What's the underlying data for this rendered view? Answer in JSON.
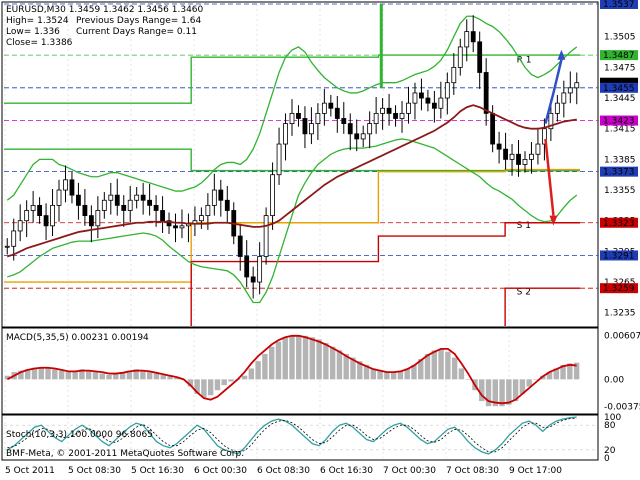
{
  "header": {
    "symbol_line": "EURUSD,M30  1.3459 1.3462 1.3456 1.3460",
    "high": "High= 1.3524",
    "low": "Low= 1.336",
    "close": "Close= 1.3386",
    "prev_range": "Previous Days Range= 1.64",
    "cur_range": "Current Days Range= 0.11"
  },
  "copyright": "BMF-Meta, © 2001-2011 MetaQuotes Software Corp.",
  "colors": {
    "background": "#ffffff",
    "grid": "#c8c8c8",
    "price": "#000000",
    "bollinger": "#32b432",
    "ma_slow": "#8b1a1a",
    "ma_fast": "#e8a000",
    "pivot_green": "#32b432",
    "support": "#c80000",
    "resistance_orange": "#e8a000",
    "forecast_up": "#3050c8",
    "forecast_down": "#dc1e1e",
    "macd_hist": "#b4b4b4",
    "macd_signal": "#c80000",
    "stoch_main": "#32a0a0",
    "stoch_signal": "#000000"
  },
  "chart_data": [
    {
      "type": "candlestick",
      "panel": "price",
      "title": "EURUSD,M30",
      "ylim": [
        1.3222,
        1.3537
      ],
      "y_ticks": [
        "1.3505",
        "1.3475",
        "1.3445",
        "1.3415",
        "1.3385",
        "1.3355",
        "1.3325",
        "1.3295",
        "1.3265",
        "1.3235"
      ],
      "x_ticks": [
        "5 Oct 2011",
        "5 Oct 08:30",
        "5 Oct 16:30",
        "6 Oct 00:30",
        "6 Oct 08:30",
        "6 Oct 16:30",
        "7 Oct 00:30",
        "7 Oct 08:30",
        "9 Oct 17:00"
      ],
      "price_labels": [
        {
          "value": "1.3537",
          "level": 1.3537,
          "color": "#1e3cb4"
        },
        {
          "value": "1.3487",
          "level": 1.3487,
          "color": "#32b432"
        },
        {
          "value": "1.3460",
          "level": 1.346,
          "color": "#000000"
        },
        {
          "value": "1.3455",
          "level": 1.3455,
          "color": "#1e3cb4"
        },
        {
          "value": "1.3423",
          "level": 1.3423,
          "color": "#c800c8"
        },
        {
          "value": "1.3373",
          "level": 1.3373,
          "color": "#1e3cb4"
        },
        {
          "value": "1.3323",
          "level": 1.3323,
          "color": "#c80000"
        },
        {
          "value": "1.3291",
          "level": 1.3291,
          "color": "#1e3cb4"
        },
        {
          "value": "1.3259",
          "level": 1.3259,
          "color": "#c80000"
        }
      ],
      "level_labels": [
        {
          "text": "R 1",
          "level": 1.348,
          "color": "#e8a000"
        },
        {
          "text": "S 1",
          "level": 1.3318,
          "color": "#e8a000"
        },
        {
          "text": "S 2",
          "level": 1.3253,
          "color": "#e8a000"
        }
      ],
      "dashed_levels": [
        {
          "level": 1.3537,
          "color": "#1e3cb4"
        },
        {
          "level": 1.3455,
          "color": "#1e3cb4"
        },
        {
          "level": 1.3423,
          "color": "#c800c8"
        },
        {
          "level": 1.3373,
          "color": "#1e3cb4"
        },
        {
          "level": 1.3291,
          "color": "#1e3cb4"
        },
        {
          "level": 1.3487,
          "color": "#32b432"
        },
        {
          "level": 1.3323,
          "color": "#c80000"
        },
        {
          "level": 1.3259,
          "color": "#c80000"
        }
      ],
      "close_series": [
        1.33,
        1.3315,
        1.3325,
        1.3335,
        1.334,
        1.333,
        1.332,
        1.334,
        1.3355,
        1.3365,
        1.335,
        1.334,
        1.333,
        1.332,
        1.3335,
        1.3345,
        1.335,
        1.334,
        1.3335,
        1.3345,
        1.335,
        1.3345,
        1.334,
        1.3335,
        1.3325,
        1.332,
        1.3318,
        1.332,
        1.3322,
        1.3325,
        1.333,
        1.334,
        1.3355,
        1.3345,
        1.3335,
        1.331,
        1.329,
        1.327,
        1.3265,
        1.329,
        1.333,
        1.337,
        1.34,
        1.342,
        1.343,
        1.3425,
        1.341,
        1.342,
        1.343,
        1.344,
        1.3435,
        1.3425,
        1.342,
        1.341,
        1.3405,
        1.341,
        1.342,
        1.343,
        1.3435,
        1.343,
        1.3425,
        1.343,
        1.344,
        1.345,
        1.3445,
        1.344,
        1.3435,
        1.3445,
        1.346,
        1.3475,
        1.3495,
        1.351,
        1.35,
        1.347,
        1.343,
        1.34,
        1.3395,
        1.3385,
        1.339,
        1.338,
        1.3385,
        1.339,
        1.34,
        1.3415,
        1.343,
        1.344,
        1.345,
        1.3455,
        1.346
      ],
      "bb_upper": [
        1.3345,
        1.335,
        1.336,
        1.337,
        1.338,
        1.3385,
        1.3385,
        1.3385,
        1.338,
        1.3378,
        1.3375,
        1.3372,
        1.337,
        1.3368,
        1.3368,
        1.337,
        1.3372,
        1.3372,
        1.337,
        1.3368,
        1.3366,
        1.3364,
        1.3362,
        1.336,
        1.3358,
        1.3356,
        1.3354,
        1.3354,
        1.3356,
        1.3358,
        1.3362,
        1.3368,
        1.3375,
        1.338,
        1.3382,
        1.3382,
        1.338,
        1.3385,
        1.3395,
        1.341,
        1.343,
        1.345,
        1.347,
        1.3485,
        1.3492,
        1.3495,
        1.349,
        1.348,
        1.3472,
        1.3465,
        1.346,
        1.3455,
        1.3452,
        1.345,
        1.345,
        1.3452,
        1.3455,
        1.3458,
        1.346,
        1.346,
        1.346,
        1.3462,
        1.3465,
        1.3468,
        1.347,
        1.3472,
        1.3476,
        1.3482,
        1.3492,
        1.3505,
        1.3518,
        1.3525,
        1.3525,
        1.3522,
        1.3518,
        1.3515,
        1.351,
        1.3503,
        1.3495,
        1.3485,
        1.3475,
        1.3468,
        1.3465,
        1.3468,
        1.3472,
        1.3478,
        1.3484,
        1.349,
        1.3495
      ],
      "bb_lower": [
        1.327,
        1.3272,
        1.3275,
        1.328,
        1.3285,
        1.329,
        1.3294,
        1.3298,
        1.33,
        1.3302,
        1.3304,
        1.3305,
        1.3305,
        1.3305,
        1.3306,
        1.3307,
        1.3308,
        1.3309,
        1.331,
        1.3311,
        1.3312,
        1.3313,
        1.3312,
        1.331,
        1.3306,
        1.33,
        1.3295,
        1.329,
        1.3285,
        1.3282,
        1.328,
        1.3279,
        1.3278,
        1.3277,
        1.3276,
        1.3272,
        1.3265,
        1.3255,
        1.3245,
        1.3245,
        1.3255,
        1.327,
        1.329,
        1.331,
        1.333,
        1.335,
        1.3362,
        1.3372,
        1.338,
        1.3385,
        1.339,
        1.3393,
        1.3395,
        1.3396,
        1.3396,
        1.3396,
        1.3397,
        1.3398,
        1.34,
        1.3402,
        1.3404,
        1.3405,
        1.3404,
        1.3402,
        1.34,
        1.3398,
        1.3396,
        1.3392,
        1.3388,
        1.3384,
        1.338,
        1.3376,
        1.3372,
        1.3368,
        1.3362,
        1.3357,
        1.3354,
        1.335,
        1.3346,
        1.334,
        1.3335,
        1.333,
        1.3326,
        1.3324,
        1.3325,
        1.333,
        1.3338,
        1.3345,
        1.335
      ],
      "ma_slow": [
        1.329,
        1.3292,
        1.3295,
        1.3298,
        1.33,
        1.3302,
        1.3304,
        1.3306,
        1.3308,
        1.331,
        1.3312,
        1.3314,
        1.3315,
        1.3316,
        1.3317,
        1.3318,
        1.3319,
        1.332,
        1.3321,
        1.3322,
        1.3323,
        1.3323,
        1.3324,
        1.3324,
        1.3324,
        1.3324,
        1.3323,
        1.3323,
        1.3322,
        1.3322,
        1.3322,
        1.3322,
        1.3323,
        1.3323,
        1.3323,
        1.3322,
        1.3321,
        1.332,
        1.3319,
        1.3319,
        1.332,
        1.3322,
        1.3325,
        1.333,
        1.3335,
        1.334,
        1.3345,
        1.335,
        1.3355,
        1.336,
        1.3364,
        1.3368,
        1.3371,
        1.3374,
        1.3377,
        1.338,
        1.3383,
        1.3386,
        1.3389,
        1.3392,
        1.3395,
        1.3398,
        1.3401,
        1.3404,
        1.3407,
        1.341,
        1.3413,
        1.3417,
        1.3421,
        1.3426,
        1.3432,
        1.3436,
        1.3438,
        1.3436,
        1.3433,
        1.343,
        1.3427,
        1.3424,
        1.3421,
        1.3418,
        1.3416,
        1.3415,
        1.3415,
        1.3416,
        1.3418,
        1.342,
        1.3422,
        1.3423,
        1.3424
      ],
      "forecast_up": [
        [
          1.344,
          1.34
        ],
        [
          1.348,
          1.342
        ],
        [
          1.351,
          1.3455
        ]
      ],
      "forecast_down": [
        [
          1.3425,
          1.3385
        ],
        [
          1.336,
          1.33
        ]
      ]
    },
    {
      "type": "histogram+line",
      "panel": "macd",
      "title": "MACD(5,35,5) 0.00231 0.00194",
      "ylim": [
        -0.0045,
        0.0068
      ],
      "y_ticks": [
        "0.00607",
        "0.00",
        "-0.00375"
      ],
      "histogram": [
        0.0005,
        0.001,
        0.0012,
        0.0014,
        0.0016,
        0.0017,
        0.0016,
        0.0014,
        0.0012,
        0.001,
        0.0012,
        0.0014,
        0.0012,
        0.001,
        0.0008,
        0.0006,
        0.0008,
        0.001,
        0.0012,
        0.0014,
        0.0012,
        0.001,
        0.0008,
        0.0006,
        0.0004,
        0.0002,
        0.0,
        -0.001,
        -0.002,
        -0.0025,
        -0.0022,
        -0.0015,
        -0.0008,
        -0.0003,
        0.0,
        0.0005,
        0.0015,
        0.0025,
        0.0035,
        0.0045,
        0.0052,
        0.0058,
        0.006,
        0.0061,
        0.006,
        0.0058,
        0.0055,
        0.005,
        0.0045,
        0.004,
        0.0035,
        0.003,
        0.0025,
        0.002,
        0.0015,
        0.0012,
        0.001,
        0.001,
        0.0012,
        0.0015,
        0.002,
        0.0028,
        0.0035,
        0.004,
        0.0042,
        0.0038,
        0.003,
        0.0015,
        0.0,
        -0.0015,
        -0.003,
        -0.0037,
        -0.0037,
        -0.0037,
        -0.0035,
        -0.003,
        -0.002,
        -0.001,
        0.0,
        0.0005,
        0.001,
        0.0015,
        0.002,
        0.0022,
        0.0023
      ],
      "signal": [
        0.0,
        0.0005,
        0.001,
        0.0013,
        0.0015,
        0.0016,
        0.0016,
        0.0015,
        0.0013,
        0.0011,
        0.0011,
        0.0012,
        0.0012,
        0.0011,
        0.001,
        0.0008,
        0.0008,
        0.0009,
        0.0011,
        0.0012,
        0.0012,
        0.0011,
        0.0009,
        0.0007,
        0.0005,
        0.0003,
        0.0,
        -0.0008,
        -0.0018,
        -0.0026,
        -0.0028,
        -0.0024,
        -0.0016,
        -0.0008,
        0.0,
        0.001,
        0.0022,
        0.0032,
        0.004,
        0.0048,
        0.0054,
        0.0058,
        0.006,
        0.006,
        0.0058,
        0.0055,
        0.0052,
        0.0048,
        0.0043,
        0.0038,
        0.0032,
        0.0027,
        0.0022,
        0.0018,
        0.0014,
        0.0012,
        0.001,
        0.001,
        0.0011,
        0.0014,
        0.0019,
        0.0026,
        0.0033,
        0.0038,
        0.0042,
        0.0042,
        0.0035,
        0.0022,
        0.0008,
        -0.0008,
        -0.0022,
        -0.003,
        -0.0032,
        -0.0033,
        -0.0032,
        -0.0028,
        -0.002,
        -0.0012,
        -0.0004,
        0.0004,
        0.001,
        0.0014,
        0.0018,
        0.002,
        0.0019
      ]
    },
    {
      "type": "line",
      "panel": "stochastic",
      "title": "Stoch(10,3,3) 100.0000 96.8065",
      "ylim": [
        0,
        100
      ],
      "y_ticks": [
        "100",
        "80",
        "20",
        "0"
      ],
      "main": [
        20,
        30,
        45,
        60,
        75,
        80,
        65,
        50,
        40,
        55,
        70,
        80,
        70,
        55,
        40,
        30,
        45,
        60,
        75,
        85,
        80,
        60,
        40,
        30,
        25,
        35,
        50,
        65,
        80,
        70,
        50,
        30,
        20,
        15,
        10,
        25,
        45,
        65,
        80,
        90,
        95,
        90,
        80,
        65,
        50,
        35,
        30,
        45,
        65,
        80,
        85,
        75,
        60,
        45,
        40,
        55,
        70,
        80,
        85,
        75,
        60,
        45,
        35,
        40,
        55,
        70,
        75,
        60,
        40,
        25,
        15,
        10,
        20,
        35,
        55,
        70,
        85,
        90,
        80,
        65,
        80,
        90,
        95,
        98,
        100
      ],
      "signal": [
        25,
        28,
        38,
        50,
        62,
        72,
        70,
        60,
        50,
        50,
        58,
        68,
        72,
        65,
        52,
        40,
        38,
        48,
        62,
        75,
        82,
        72,
        55,
        40,
        30,
        30,
        40,
        55,
        68,
        72,
        62,
        45,
        30,
        20,
        15,
        18,
        32,
        52,
        70,
        83,
        90,
        92,
        86,
        75,
        60,
        45,
        35,
        38,
        52,
        68,
        80,
        80,
        70,
        55,
        45,
        48,
        60,
        72,
        80,
        80,
        70,
        55,
        42,
        38,
        45,
        60,
        70,
        68,
        55,
        38,
        25,
        15,
        15,
        25,
        42,
        58,
        75,
        85,
        85,
        75,
        75,
        85,
        92,
        96,
        97
      ]
    }
  ]
}
